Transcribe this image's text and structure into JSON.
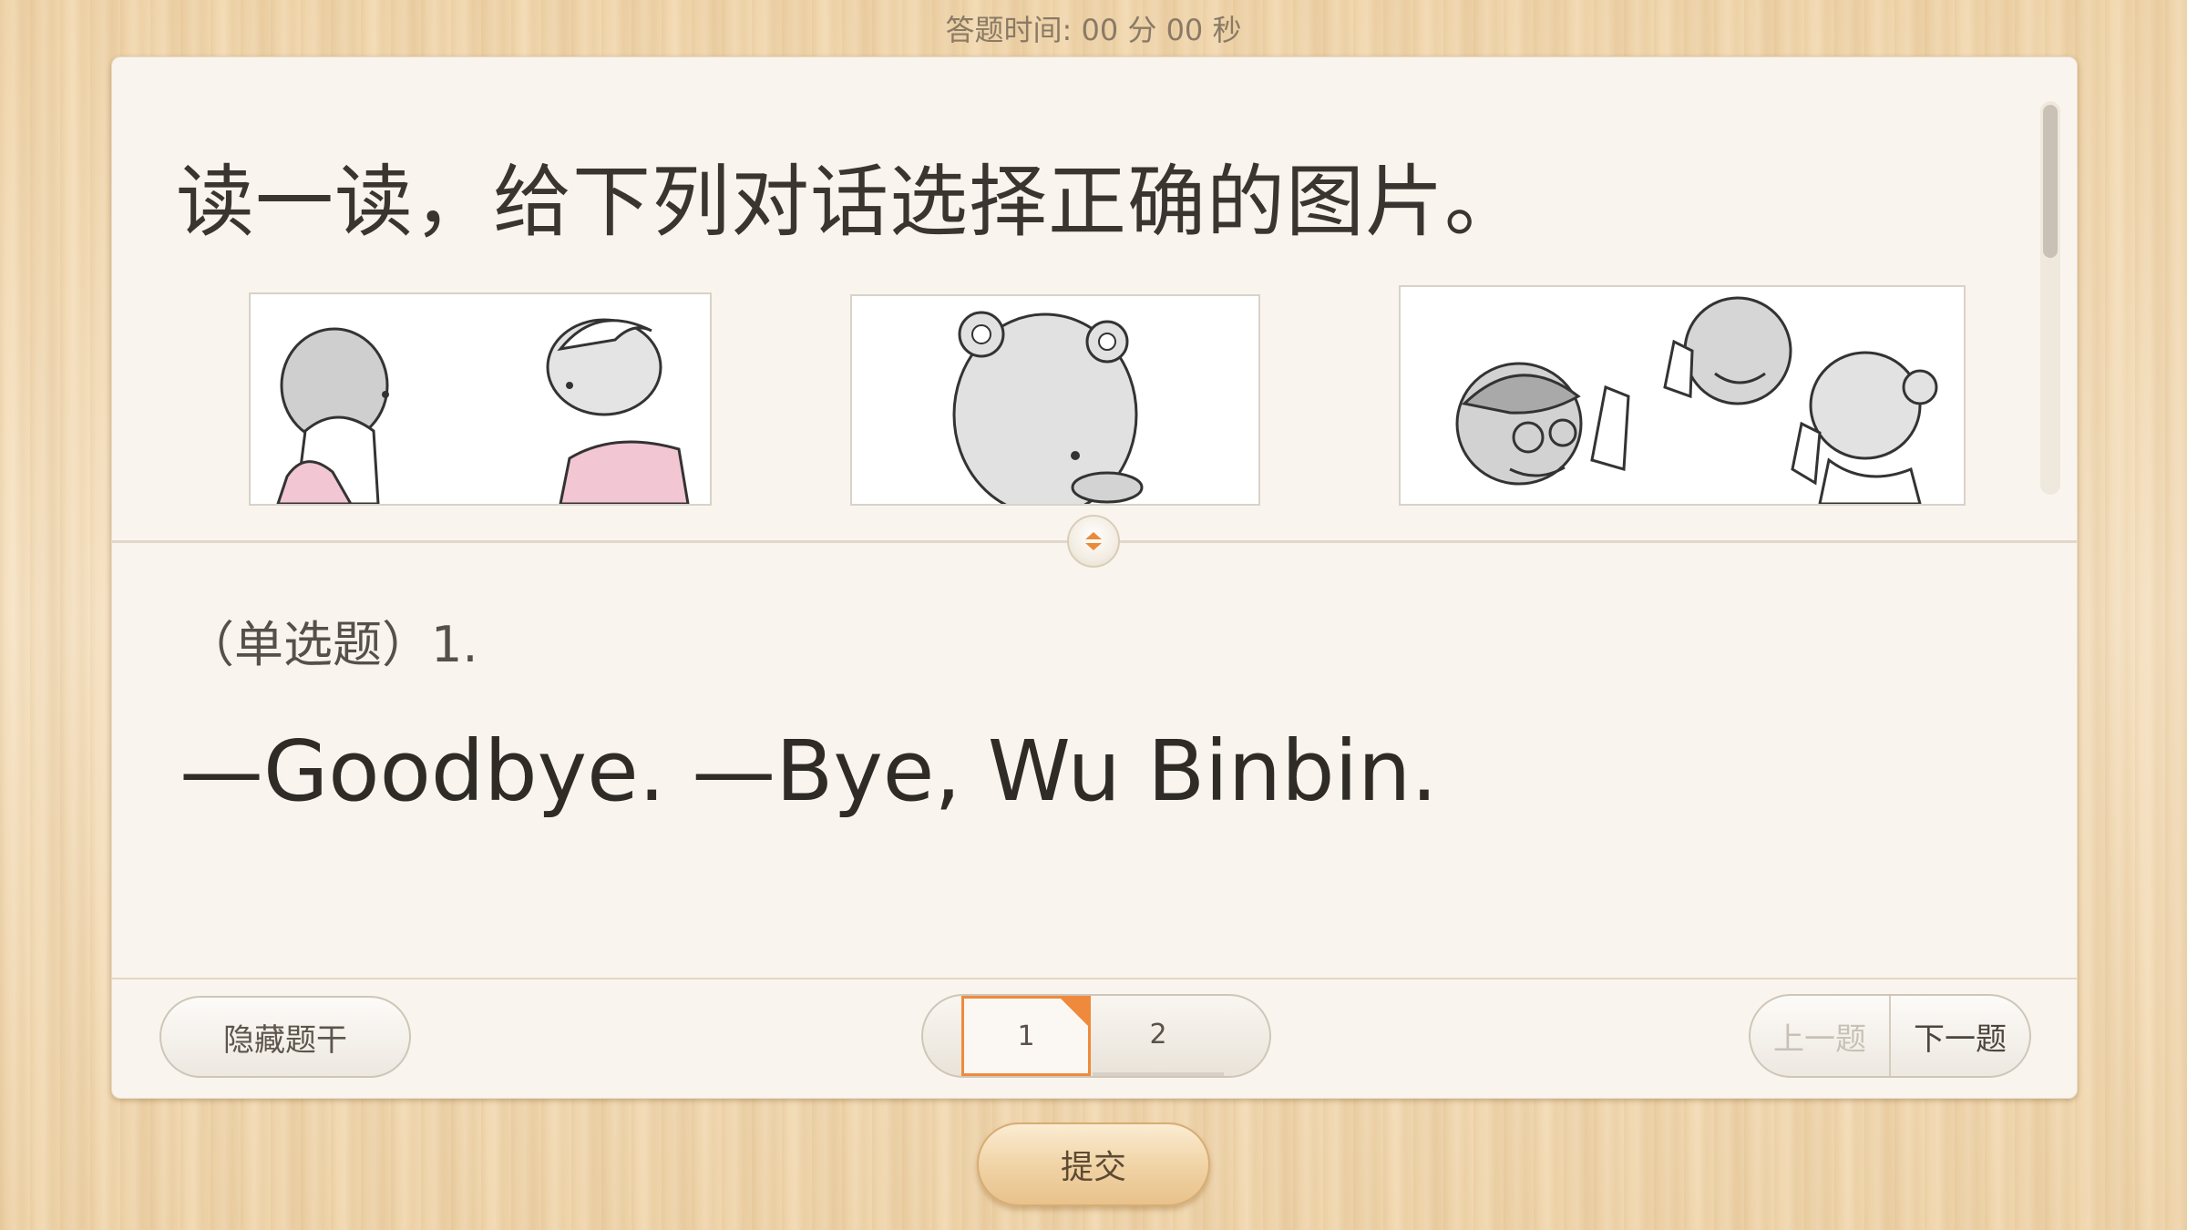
{
  "timer": {
    "label": "答题时间:",
    "minutes": "00",
    "minutes_unit": "分",
    "seconds": "00",
    "seconds_unit": "秒"
  },
  "stem": {
    "instruction": "读一读，给下列对话选择正确的图片。"
  },
  "images": [
    {
      "name": "picture-two-kids-facing"
    },
    {
      "name": "picture-bear"
    },
    {
      "name": "picture-kids-waving"
    }
  ],
  "question": {
    "type_label": "（单选题）1.",
    "text": "—Goodbye. —Bye, Wu Binbin."
  },
  "footer": {
    "hide_stem_label": "隐藏题干",
    "pages": [
      "1",
      "2"
    ],
    "current_page": "1",
    "prev_label": "上一题",
    "next_label": "下一题"
  },
  "submit_label": "提交",
  "colors": {
    "accent": "#ef8a3c",
    "card": "#f9f5ee"
  },
  "icons": {
    "toggle": "collapse-toggle-icon",
    "page_marker": "current-page-corner-icon"
  }
}
